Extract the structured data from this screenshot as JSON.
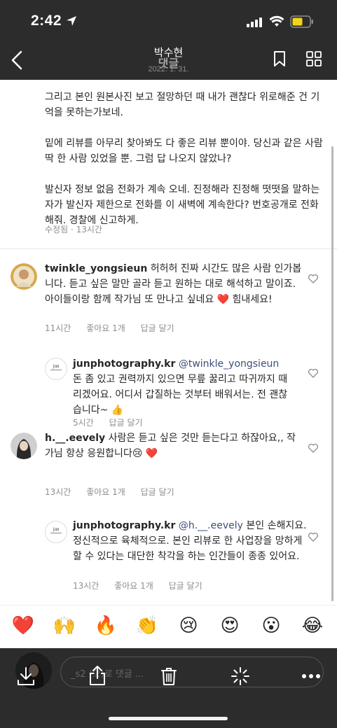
{
  "status_bar": {
    "time": "2:42"
  },
  "nav": {
    "title": "박수현",
    "title_behind": "댓글",
    "date": "2022. 1. 31."
  },
  "caption": {
    "paragraphs": [
      "그리고 본인 원본사진 보고 절망하던 때 내가 괜찮다 위로해준 건 기억을 못하는가보네.",
      "밑에 리뷰를 아무리 찾아봐도 다 좋은 리뷰 뿐이야. 당신과 같은 사람 딱 한 사람 있었을 뿐. 그럼 답 나오지 않았나?",
      "발신자 정보 없음 전화가 계속 오네. 진정해라 진정해 떳떳을 말하는 자가 발신자 제한으로 전화를 이 새벽에 계속한다? 번호공개로 전화해줘. 경찰에 신고하게."
    ],
    "edited": "수정됨",
    "time": "13시간"
  },
  "comments": [
    {
      "username": "twinkle_yongsieun",
      "text": " 허허허 진짜 시간도 많은 사람 인가봅니다. 듣고 싶은 말만 골라 듣고 원하는 대로 해석하고 말이죠. 아이들이랑 함께 작가님 또 만나고 싶네요 ❤️ 힘내세요!",
      "time": "11시간",
      "likes": "좋아요 1개",
      "reply": "답글 달기"
    },
    {
      "username": "junphotography.kr",
      "mention": " @twinkle_yongsieun",
      "text": " 돈 좀 있고 권력까지 있으면 무릎 꿇리고 따귀까지 때리겠어요. 어디서 갑질하는 것부터 배워서는. 전 괜찮습니다~ 👍",
      "time": "5시간",
      "reply": "답글 달기"
    },
    {
      "username": "h.__.eevely",
      "text": " 사람은 듣고 싶은 것만 듣는다고 하잖아요,, 작가님 항상 응원합니다😢 ❤️",
      "time": "13시간",
      "likes": "좋아요 1개",
      "reply": "답글 달기"
    },
    {
      "username": "junphotography.kr",
      "mention": " @h.__.eevely",
      "text": " 본인 손해지요. 정신적으로 육체적으로. 본인 리뷰로 한 사업장을 망하게 할 수 있다는 대단한 착각을 하는 인간들이 종종 있어요.",
      "time": "13시간",
      "likes": "좋아요 1개",
      "reply": "답글 달기"
    }
  ],
  "emoji_bar": [
    "❤️",
    "🙌",
    "🔥",
    "👏",
    "😢",
    "😍",
    "😮",
    "😂"
  ],
  "comment_input": {
    "placeholder": "_s2 (으)로 댓글 ..."
  },
  "colors": {
    "chrome": "#2c2c2c",
    "mention": "#3b4f7a",
    "heart": "#e0245e"
  },
  "icons": [
    "back-icon",
    "bookmark-icon",
    "grid-icon",
    "heart-outline-icon",
    "download-icon",
    "share-icon",
    "trash-icon",
    "sparkle-icon",
    "more-icon"
  ]
}
